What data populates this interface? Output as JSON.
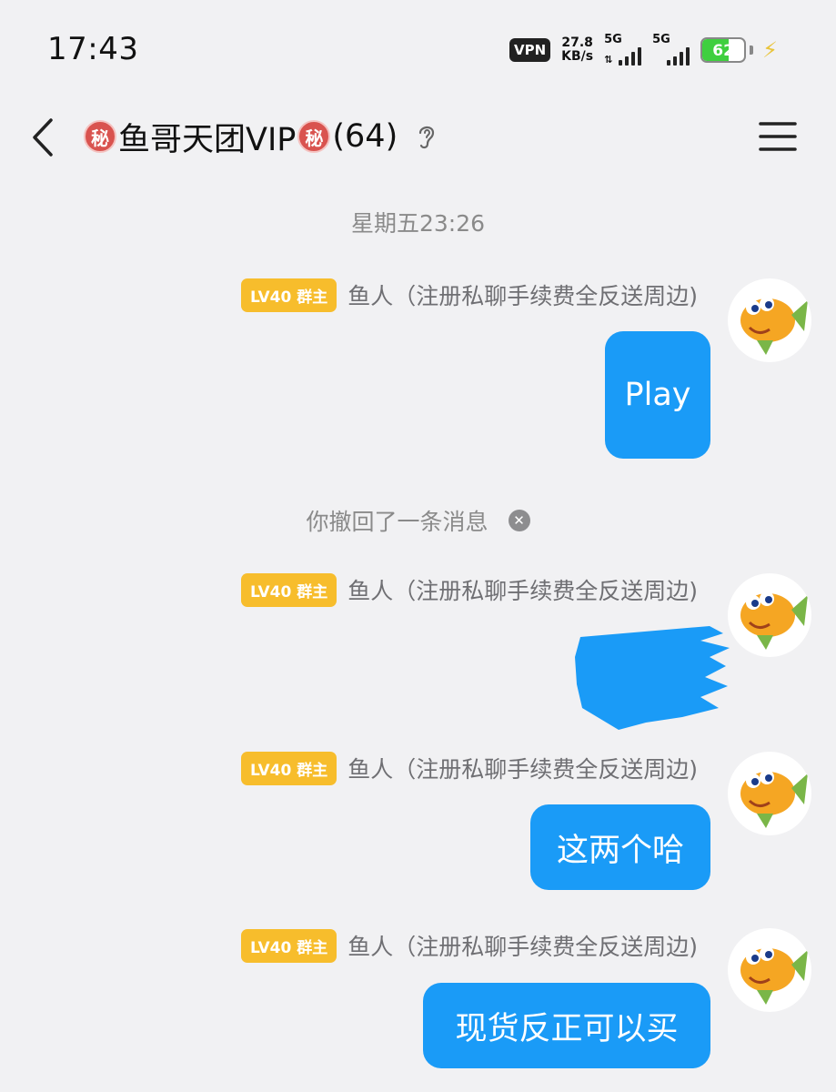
{
  "status_bar": {
    "time": "17:43",
    "vpn": "VPN",
    "speed_value": "27.8",
    "speed_unit": "KB/s",
    "sim1_gen": "5G",
    "sim2_gen": "5G",
    "battery_percent": "62",
    "battery_level": 0.62,
    "battery_color": "#3fcf3f"
  },
  "header": {
    "secret_glyph": "秘",
    "title": "鱼哥天团VIP",
    "member_count": "(64)",
    "icons": [
      "back-arrow-icon",
      "secret-badge-icon",
      "ear-icon",
      "menu-icon"
    ]
  },
  "chat": {
    "timestamp": "星期五23:26",
    "recall_note": "你撤回了一条消息",
    "bubble_color": "#1a9bf7",
    "badge_color": "#f7bd2c",
    "messages": [
      {
        "badge": "LV40 群主",
        "sender": "鱼人（注册私聊手续费全反送周边)",
        "text": "Play"
      },
      {
        "badge": "LV40 群主",
        "sender": "鱼人（注册私聊手续费全反送周边)",
        "text": ""
      },
      {
        "badge": "LV40 群主",
        "sender": "鱼人（注册私聊手续费全反送周边)",
        "text": "这两个哈"
      },
      {
        "badge": "LV40 群主",
        "sender": "鱼人（注册私聊手续费全反送周边)",
        "text": "现货反正可以买"
      }
    ]
  }
}
